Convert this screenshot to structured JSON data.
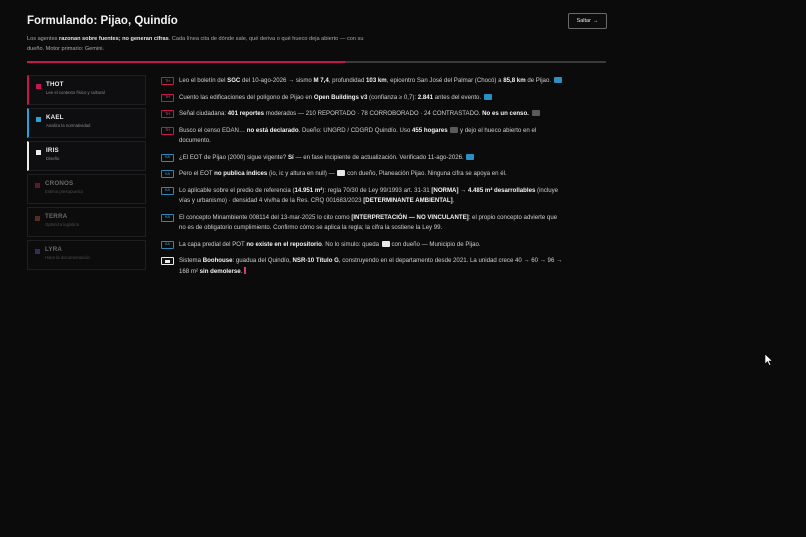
{
  "header": {
    "title": "Formulando: Pijao, Quindío",
    "skip_label": "Saltar",
    "skip_arrow": "→",
    "subtitle_1": "Los agentes ",
    "subtitle_b1": "razonan sobre fuentes; no generan cifras",
    "subtitle_2": ". Cada línea cita de dónde sale, qué deriva o qué hueco deja abierto — con su dueño. Motor primario: Gemini."
  },
  "progress": {
    "value": 0.55,
    "fill_color": "#c3174d"
  },
  "agents": [
    {
      "name": "THOT",
      "desc": "Lee el contexto físico y cultural",
      "color": "#c3174d"
    },
    {
      "name": "KAEL",
      "desc": "Analiza la normatividad",
      "color": "#2ca1d9"
    },
    {
      "name": "IRIS",
      "desc": "Diseño",
      "color": "#ececec"
    },
    {
      "name": "CRONOS",
      "desc": "Estima presupuesto",
      "color": "#5a1a2c"
    },
    {
      "name": "TERRA",
      "desc": "Optimiza logística",
      "color": "#5a2a20"
    },
    {
      "name": "LYRA",
      "desc": "Hace la documentación",
      "color": "#3a2a55"
    }
  ],
  "log": {
    "tags": {
      "thot": "TH",
      "kael": "KA"
    },
    "e1": {
      "a": "Leo el boletín del ",
      "b1": "SGC",
      "c": " del 10-ago-2026 → sismo ",
      "b2": "M 7,4",
      "d": ", profundidad ",
      "b3": "103 km",
      "e": ", epicentro San José del Palmar (Chocó) a ",
      "b4": "85,8 km",
      "f": " de Pijao."
    },
    "e2": {
      "a": "Cuento las edificaciones del polígono de Pijao en ",
      "b1": "Open Buildings v3",
      "c": " (confianza ≥ 0,7): ",
      "b2": "2.841",
      "d": " antes del evento."
    },
    "e3": {
      "a": "Señal ciudadana: ",
      "b1": "401 reportes",
      "c": " moderados — 210 REPORTADO · 78 CORROBORADO · 24 CONTRASTADO. ",
      "b2": "No es un censo."
    },
    "e4": {
      "a": "Busco el censo EDAN… ",
      "b1": "no está declarado",
      "c": ". Dueño: UNGRD / CDGRD Quindío. Uso ",
      "b2": "455 hogares",
      "d": " y dejo el hueco abierto en el documento."
    },
    "e5": {
      "a": "¿El EOT de Pijao (2000) sigue vigente? ",
      "b1": "Sí",
      "c": " — en fase incipiente de actualización. Verificado 11-ago-2026."
    },
    "e6": {
      "a": "Pero el EOT ",
      "b1": "no publica índices",
      "c": " (io, ic y altura en null) — ",
      "d": " con dueño, Planeación Pijao. Ninguna cifra se apoya en él."
    },
    "e7": {
      "a": "Lo aplicable sobre el predio de referencia (",
      "b1": "14.951 m²",
      "c": "): regla 70/30 de Ley 99/1993 art. 31-31 ",
      "b2": "[NORMA]",
      "d": " → ",
      "b3": "4.485 m² desarrollables",
      "e": " (incluye vías y urbanismo) · densidad 4 viv/ha de la Res. CRQ 001683/2023 ",
      "b4": "[DETERMINANTE AMBIENTAL]",
      "f": "."
    },
    "e8": {
      "a": "El concepto Minambiente 008114 del 13-mar-2025 lo cito como ",
      "b1": "[INTERPRETACIÓN — NO VINCULANTE]",
      "c": ": el propio concepto advierte que no es de obligatorio cumplimiento. Confirmo cómo se aplica la regla; la cifra la sostiene la Ley 99."
    },
    "e9": {
      "a": "La capa predial del POT ",
      "b1": "no existe en el repositorio",
      "c": ". No lo simulo: queda ",
      "d": " con dueño — Municipio de Pijao."
    },
    "e10": {
      "a": "Sistema ",
      "b1": "Boohouse",
      "c": ": guadua del Quindío, ",
      "b2": "NSR-10 Título G",
      "d": ", construyendo en el departamento desde 2021. La unidad crece 40 → 60 → 96 → 168 m² ",
      "b3": "sin demolerse",
      "e": "."
    }
  },
  "icons": {
    "mouse": "cursor-arrow-icon",
    "chip_blue": "#2a8fc5",
    "chip_gray": "#5a5a5a"
  }
}
